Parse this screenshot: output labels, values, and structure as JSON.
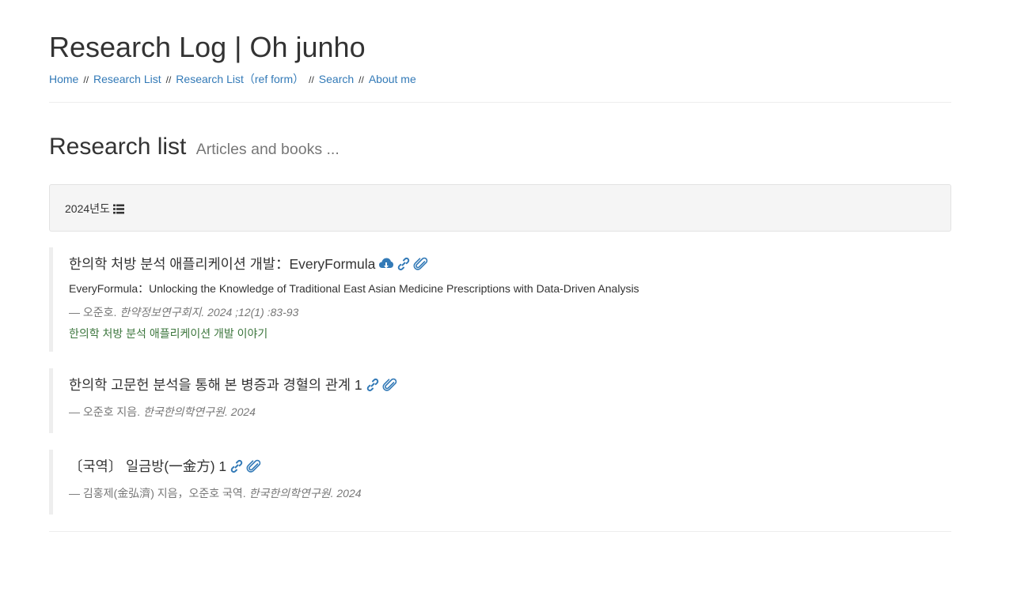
{
  "site": {
    "title": "Research Log | Oh junho"
  },
  "nav": {
    "items": [
      {
        "label": "Home"
      },
      {
        "label": "Research List"
      },
      {
        "label": "Research List（ref form）"
      },
      {
        "label": "Search"
      },
      {
        "label": "About me"
      }
    ],
    "separator": "//"
  },
  "page": {
    "title": "Research list",
    "subtitle": "Articles and books ..."
  },
  "year_group": {
    "label": "2024년도",
    "icon": "list-icon"
  },
  "entries": [
    {
      "title": "한의학 처방 분석 애플리케이션 개발：EveryFormula",
      "subtitle": "EveryFormula：Unlocking the Knowledge of Traditional East Asian Medicine Prescriptions with Data-Driven Analysis",
      "meta_prefix": "— 오준호.",
      "meta_source": "한약정보연구회지. 2024 ;12(1) :83-93",
      "link": "한의학 처방 분석 애플리케이션 개발 이야기",
      "icons": [
        "cloud-download-icon",
        "link-icon",
        "paperclip-icon"
      ]
    },
    {
      "title": "한의학 고문헌 분석을 통해 본 병증과 경혈의 관계 1",
      "meta_prefix": "— 오준호 지음.",
      "meta_source": "한국한의학연구원. 2024",
      "icons": [
        "link-icon",
        "paperclip-icon"
      ]
    },
    {
      "title": "〔국역〕 일금방(一金方) 1",
      "meta_prefix": "— 김홍제(金弘濟) 지음，오준호 국역.",
      "meta_source": "한국한의학연구원. 2024",
      "icons": [
        "link-icon",
        "paperclip-icon"
      ]
    }
  ],
  "colors": {
    "link": "#337ab7",
    "muted": "#777777",
    "green": "#3c763d",
    "panel_bg": "#f5f5f5"
  }
}
